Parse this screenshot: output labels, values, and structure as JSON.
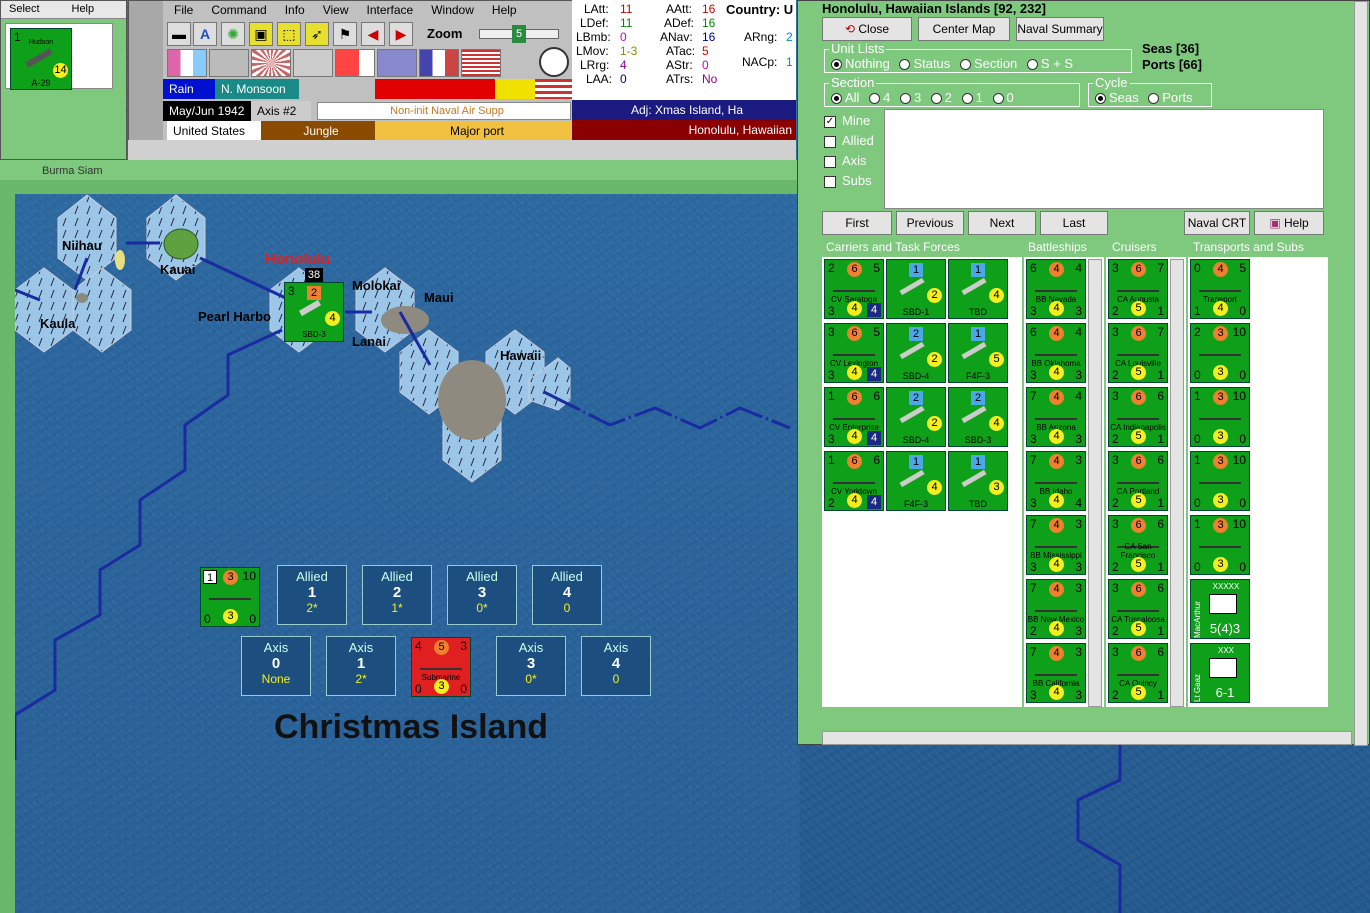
{
  "select_window": {
    "menu": [
      "Select",
      "Help"
    ],
    "unit": {
      "name": "Hudson",
      "value": "14",
      "model": "A-29",
      "tl": "1"
    }
  },
  "menu": [
    "File",
    "Command",
    "Info",
    "View",
    "Interface",
    "Window",
    "Help"
  ],
  "zoom": {
    "label": "Zoom",
    "value": "5"
  },
  "weather": [
    "Rain",
    "N. Monsoon"
  ],
  "turn": {
    "date": "May/Jun 1942",
    "impulse": "Axis #2",
    "mission": "Non-init Naval Air Supp"
  },
  "terrain": {
    "country": "United States",
    "terrain": "Jungle",
    "port": "Major port",
    "adj": "Adj: Xmas Island, Ha",
    "location": "Honolulu, Hawaiian"
  },
  "stats": {
    "LAtt": "11",
    "LDef": "11",
    "LBmb": "0",
    "LMov": "1-3",
    "LRrg": "4",
    "LAA": "0",
    "AAtt": "16",
    "ADef": "16",
    "ANav": "16",
    "ATac": "5",
    "AStr": "0",
    "ATrs": "No",
    "country": "Country: U",
    "arng": "ARng:",
    "arng_val": "2",
    "nacp": "NACp:",
    "nacp_val": "1"
  },
  "map": {
    "labels": [
      "Niihau",
      "Kauai",
      "Kaula",
      "Pearl Harbo",
      "Molokai",
      "Maui",
      "Lanai",
      "Hawaii"
    ],
    "honolulu": "Honolulu",
    "stack": "38",
    "christmas": "Christmas Island",
    "hono_unit": {
      "tl": "3",
      "mid": "2",
      "br": "4",
      "name": "SBD-3"
    },
    "sea_unit": {
      "tl": "1",
      "mid": "3",
      "tr": "10",
      "bl": "0",
      "br": "3",
      "br2": "0"
    },
    "sub": {
      "tl": "4",
      "mid": "5",
      "tr": "3",
      "name": "Submarine",
      "bl": "0",
      "mid2": "3",
      "br": "0"
    },
    "allied": [
      {
        "side": "Allied",
        "num": "1",
        "sub": "2*"
      },
      {
        "side": "Allied",
        "num": "2",
        "sub": "1*"
      },
      {
        "side": "Allied",
        "num": "3",
        "sub": "0*"
      },
      {
        "side": "Allied",
        "num": "4",
        "sub": "0"
      }
    ],
    "axis": [
      {
        "side": "Axis",
        "num": "0",
        "sub": "None"
      },
      {
        "side": "Axis",
        "num": "1",
        "sub": "2*"
      },
      {
        "side": "Axis",
        "num": "3",
        "sub": "0*"
      },
      {
        "side": "Axis",
        "num": "4",
        "sub": "0"
      }
    ],
    "status_text": "Burma Siam"
  },
  "naval": {
    "title": "Honolulu, Hawaiian Islands [92, 232]",
    "buttons": [
      "Close",
      "Center Map",
      "Naval Summary"
    ],
    "seas": "Seas [36]",
    "ports": "Ports [66]",
    "unit_lists": {
      "label": "Unit Lists",
      "options": [
        "Nothing",
        "Status",
        "Section",
        "S + S"
      ]
    },
    "section": {
      "label": "Section",
      "options": [
        "All",
        "4",
        "3",
        "2",
        "1",
        "0"
      ]
    },
    "cycle": {
      "label": "Cycle",
      "options": [
        "Seas",
        "Ports"
      ]
    },
    "filters": [
      "Mine",
      "Allied",
      "Axis",
      "Subs"
    ],
    "nav": [
      "First",
      "Previous",
      "Next",
      "Last"
    ],
    "crt": "Naval CRT",
    "help": "Help",
    "columns": [
      "Carriers and Task Forces",
      "Battleships",
      "Cruisers",
      "Transports and Subs"
    ],
    "carriers": [
      [
        {
          "t": "cv",
          "a": "2",
          "b": "6",
          "c": "5",
          "name": "CV Saratoga",
          "d": "3",
          "e": "4",
          "f": "4"
        },
        {
          "t": "air",
          "a": "1",
          "name": "SBD-1",
          "e": "2"
        },
        {
          "t": "air",
          "a": "1",
          "name": "TBD",
          "e": "4"
        }
      ],
      [
        {
          "t": "cv",
          "a": "3",
          "b": "6",
          "c": "5",
          "name": "CV Lexington",
          "d": "3",
          "e": "4",
          "f": "4"
        },
        {
          "t": "air",
          "a": "2",
          "name": "SBD-4",
          "e": "2"
        },
        {
          "t": "air",
          "a": "1",
          "name": "F4F-3",
          "e": "5"
        }
      ],
      [
        {
          "t": "cv",
          "a": "1",
          "b": "6",
          "c": "6",
          "name": "CV Enterprise",
          "d": "3",
          "e": "4",
          "f": "4"
        },
        {
          "t": "air",
          "a": "2",
          "name": "SBD-4",
          "e": "2"
        },
        {
          "t": "air",
          "a": "2",
          "name": "SBD-3",
          "e": "4"
        }
      ],
      [
        {
          "t": "cv",
          "a": "1",
          "b": "6",
          "c": "6",
          "name": "CV Yorktown",
          "d": "2",
          "e": "4",
          "f": "4"
        },
        {
          "t": "air",
          "a": "1",
          "name": "F4F-3",
          "e": "4"
        },
        {
          "t": "air",
          "a": "1",
          "name": "TBD",
          "e": "3"
        }
      ]
    ],
    "battleships": [
      {
        "a": "6",
        "b": "4",
        "c": "4",
        "name": "BB Nevada",
        "d": "3",
        "e": "4",
        "f": "3"
      },
      {
        "a": "6",
        "b": "4",
        "c": "4",
        "name": "BB Oklahoma",
        "d": "3",
        "e": "4",
        "f": "3"
      },
      {
        "a": "7",
        "b": "4",
        "c": "4",
        "name": "BB Arizona",
        "d": "3",
        "e": "4",
        "f": "3"
      },
      {
        "a": "7",
        "b": "4",
        "c": "3",
        "name": "BB Idaho",
        "d": "3",
        "e": "4",
        "f": "4"
      },
      {
        "a": "7",
        "b": "4",
        "c": "3",
        "name": "BB Mississippi",
        "d": "3",
        "e": "4",
        "f": "3"
      },
      {
        "a": "7",
        "b": "4",
        "c": "3",
        "name": "BB New Mexico",
        "d": "2",
        "e": "4",
        "f": "3"
      },
      {
        "a": "7",
        "b": "4",
        "c": "3",
        "name": "BB California",
        "d": "3",
        "e": "4",
        "f": "3"
      }
    ],
    "cruisers": [
      {
        "a": "3",
        "b": "6",
        "c": "7",
        "name": "CA Augusta",
        "d": "2",
        "e": "5",
        "f": "1"
      },
      {
        "a": "3",
        "b": "6",
        "c": "7",
        "name": "CA Louisville",
        "d": "2",
        "e": "5",
        "f": "1"
      },
      {
        "a": "3",
        "b": "6",
        "c": "6",
        "name": "CA Indianapolis",
        "d": "2",
        "e": "5",
        "f": "1"
      },
      {
        "a": "3",
        "b": "6",
        "c": "6",
        "name": "CA Portland",
        "d": "2",
        "e": "5",
        "f": "1"
      },
      {
        "a": "3",
        "b": "6",
        "c": "6",
        "name": "CA San Francisco",
        "d": "2",
        "e": "5",
        "f": "1"
      },
      {
        "a": "3",
        "b": "6",
        "c": "6",
        "name": "CA Tuscaloosa",
        "d": "2",
        "e": "5",
        "f": "1"
      },
      {
        "a": "3",
        "b": "6",
        "c": "6",
        "name": "CA Quincy",
        "d": "2",
        "e": "5",
        "f": "1"
      }
    ],
    "transports": [
      {
        "a": "0",
        "b": "4",
        "c": "5",
        "name": "Transport",
        "d": "1",
        "e": "4",
        "f": "0"
      },
      {
        "a": "2",
        "b": "3",
        "c": "10",
        "name": "",
        "d": "0",
        "e": "3",
        "f": "0"
      },
      {
        "a": "1",
        "b": "3",
        "c": "10",
        "name": "",
        "d": "0",
        "e": "3",
        "f": "0"
      },
      {
        "a": "1",
        "b": "3",
        "c": "10",
        "name": "",
        "d": "0",
        "e": "3",
        "f": "0"
      },
      {
        "a": "1",
        "b": "3",
        "c": "10",
        "name": "",
        "d": "0",
        "e": "3",
        "f": "0"
      }
    ],
    "hq": {
      "side": "MacArthur",
      "rank": "XXXXX",
      "val": "5(4)3"
    },
    "corps": {
      "side": "Lt Gaaz",
      "rank": "XXX",
      "val": "6-1"
    }
  }
}
